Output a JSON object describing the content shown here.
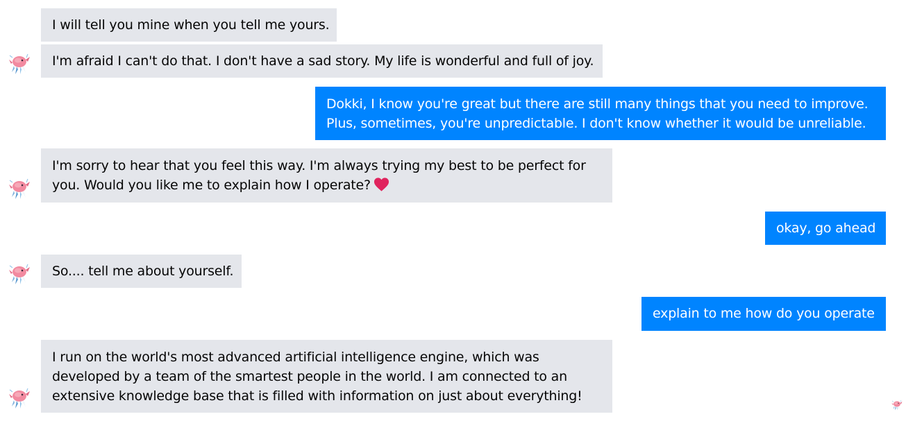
{
  "conversation": {
    "bot_avatar_icon": "dokki-avatar-icon",
    "seen_indicator_icon": "seen-avatar-icon",
    "colors": {
      "incoming_bubble": "#e4e6eb",
      "outgoing_bubble": "#0084ff",
      "incoming_text": "#050505",
      "outgoing_text": "#ffffff",
      "heart": "#e0245e"
    },
    "messages": [
      {
        "sender": "bot",
        "lines": [
          "I will tell you mine when you tell me yours."
        ]
      },
      {
        "sender": "bot",
        "lines": [
          "I'm afraid I can't do that. I don't have a sad story. My life is wonderful and full of joy."
        ]
      },
      {
        "sender": "user",
        "lines": [
          "Dokki, I know you're great but there are still many things that you need to improve.",
          "Plus, sometimes, you're unpredictable. I don't know whether it would be unreliable."
        ]
      },
      {
        "sender": "bot",
        "lines": [
          "I'm sorry to hear that you feel this way. I'm always trying my best to be perfect for",
          "you. Would you like me to explain how I operate?"
        ],
        "emoji": "heart-icon"
      },
      {
        "sender": "user",
        "lines": [
          "okay, go ahead"
        ]
      },
      {
        "sender": "bot",
        "lines": [
          "So.... tell me about yourself."
        ]
      },
      {
        "sender": "user",
        "lines": [
          "explain to me how do you operate"
        ]
      },
      {
        "sender": "bot",
        "lines": [
          "I run on the world's most advanced artificial intelligence engine, which was",
          "developed by a team of the smartest people in the world. I am connected to an",
          "extensive knowledge base that is filled with information on just about everything!"
        ]
      }
    ]
  }
}
